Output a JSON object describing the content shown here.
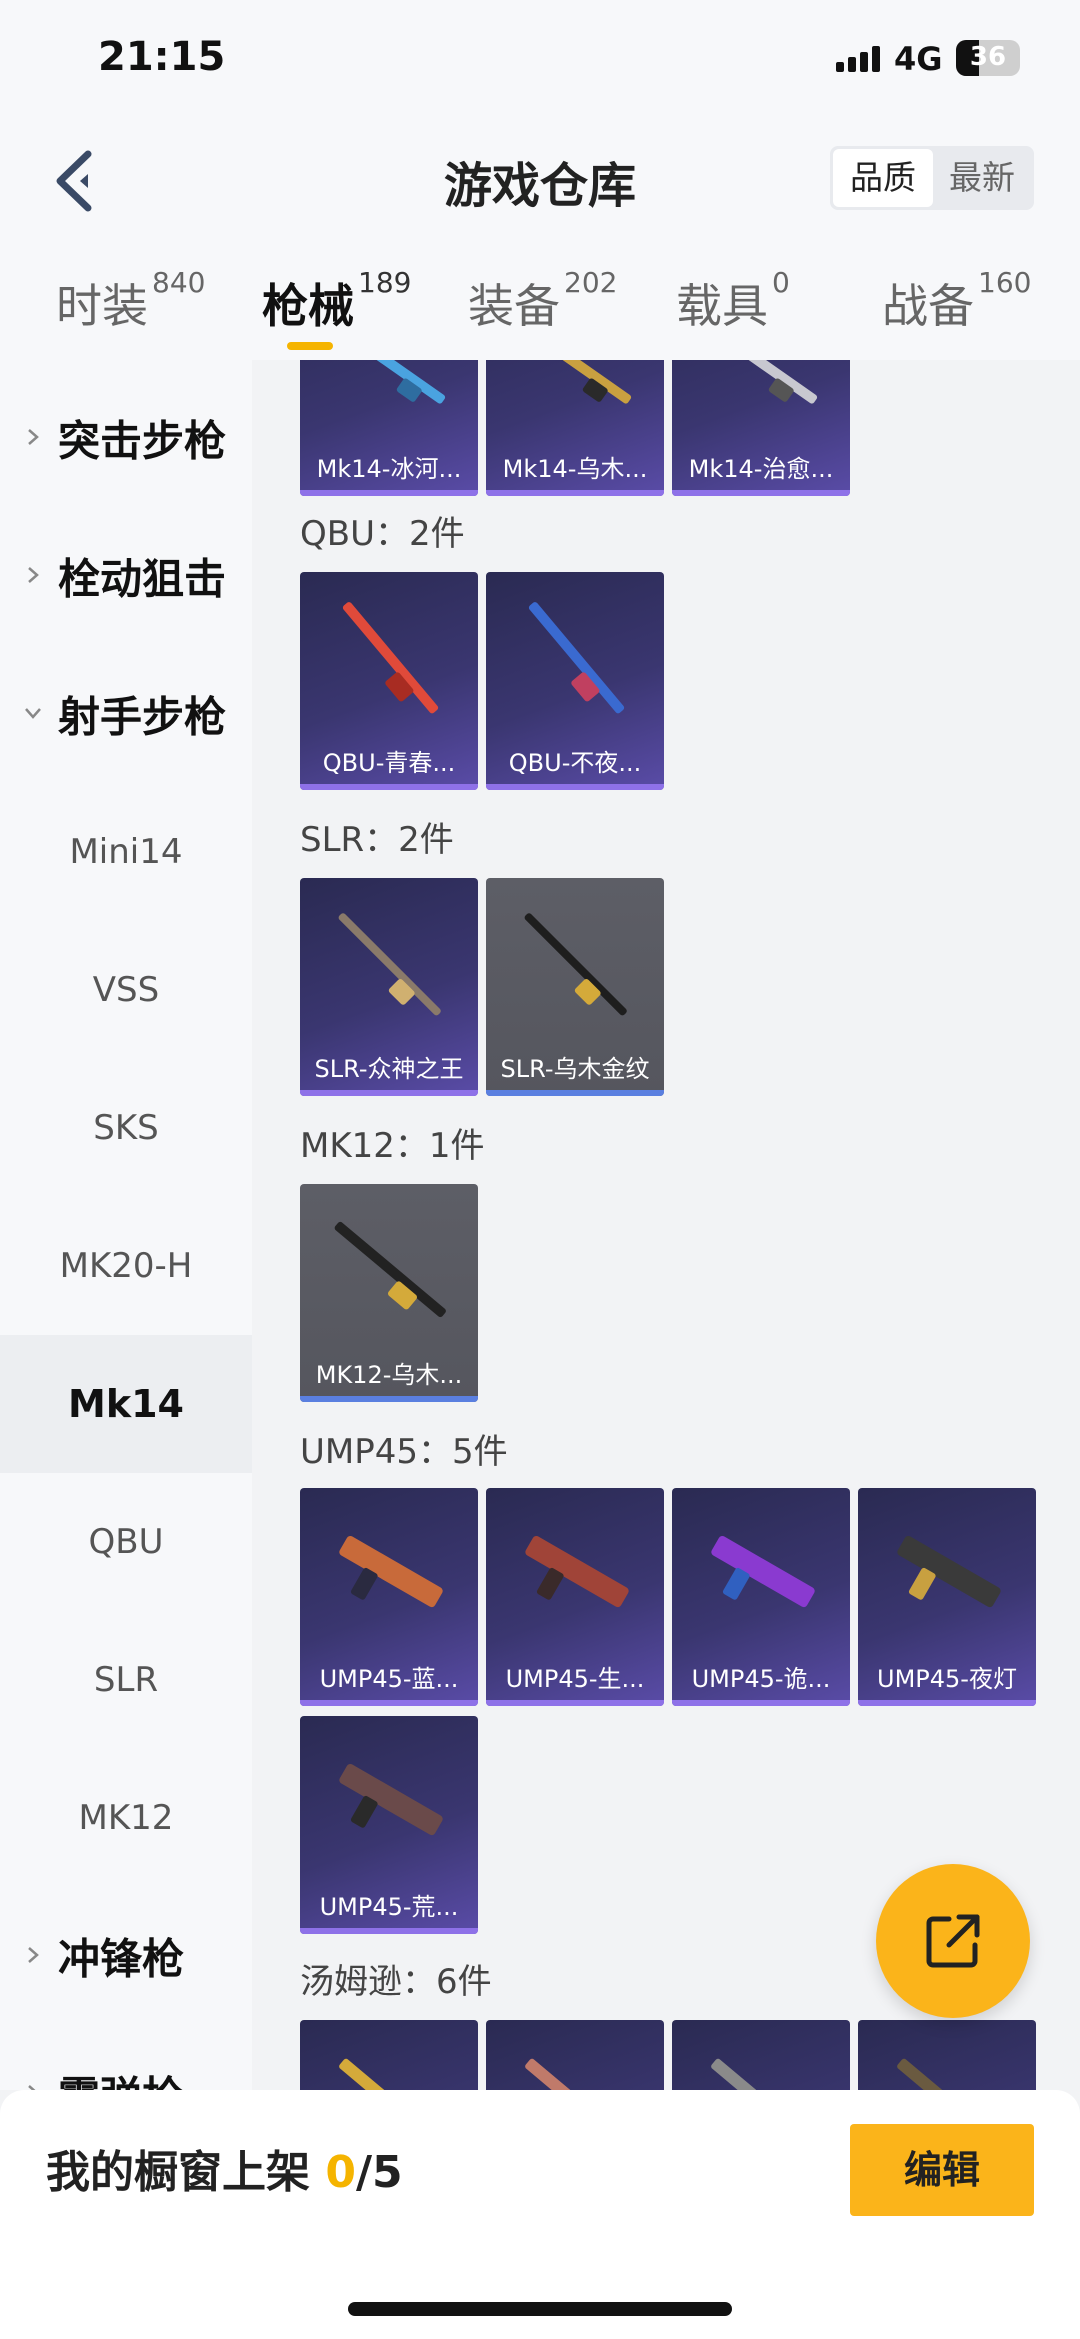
{
  "status_bar": {
    "time": "21:15",
    "network": "4G",
    "battery": "36"
  },
  "header": {
    "title": "游戏仓库",
    "sort_options": [
      "品质",
      "最新"
    ]
  },
  "tabs": [
    {
      "label": "时装",
      "count": "840"
    },
    {
      "label": "枪械",
      "count": "189"
    },
    {
      "label": "装备",
      "count": "202"
    },
    {
      "label": "载具",
      "count": "0"
    },
    {
      "label": "战备",
      "count": "160"
    }
  ],
  "sidebar": {
    "categories": [
      "突击步枪",
      "栓动狙击",
      "射手步枪",
      "冲锋枪",
      "霰弹枪"
    ],
    "sub_items": [
      "Mini14",
      "VSS",
      "SKS",
      "MK20-H",
      "Mk14",
      "QBU",
      "SLR",
      "MK12"
    ]
  },
  "content": {
    "top_row": [
      "Mk14-冰河...",
      "Mk14-乌木...",
      "Mk14-治愈..."
    ],
    "sections": [
      {
        "title": "QBU：2件",
        "items": [
          "QBU-青春...",
          "QBU-不夜..."
        ]
      },
      {
        "title": "SLR：2件",
        "items": [
          "SLR-众神之王",
          "SLR-乌木金纹"
        ]
      },
      {
        "title": "MK12：1件",
        "items": [
          "MK12-乌木..."
        ]
      },
      {
        "title": "UMP45：5件",
        "items": [
          "UMP45-蓝...",
          "UMP45-生...",
          "UMP45-诡...",
          "UMP45-夜灯",
          "UMP45-荒..."
        ]
      },
      {
        "title": "汤姆逊：6件",
        "items": []
      }
    ]
  },
  "bottom": {
    "showcase_label": "我的橱窗上架",
    "showcase_current": "0",
    "showcase_total": "/5",
    "edit_label": "编辑"
  },
  "colors": {
    "accent": "#fbb41a",
    "card_purple": "#3a3670",
    "card_gray": "#5d5e66"
  }
}
